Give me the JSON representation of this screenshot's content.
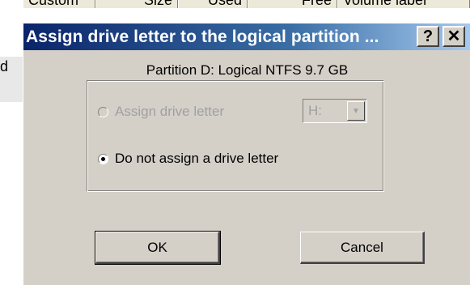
{
  "background_window": {
    "columns": [
      "Custom",
      "Size",
      "Used",
      "Free",
      "Volume label"
    ],
    "row_fragment": "d"
  },
  "dialog": {
    "title": "Assign drive letter to the logical partition ...",
    "help_label": "?",
    "close_label": "✕",
    "partition_info": "Partition D: Logical  NTFS  9.7 GB",
    "options": {
      "assign_label": "Assign drive letter",
      "assign_selected": false,
      "assign_enabled": false,
      "noassign_label": "Do not assign a drive letter",
      "noassign_selected": true
    },
    "drive_select": {
      "value": "H:",
      "arrow": "▼"
    },
    "ok_label": "OK",
    "cancel_label": "Cancel"
  },
  "colors": {
    "titlebar_start": "#0a246a",
    "titlebar_end": "#a6caf0",
    "dialog_face": "#d4d0c8",
    "disabled_text": "#a0a0a0"
  },
  "icons": {
    "help": "help-icon",
    "close": "close-icon",
    "dropdown": "chevron-down-icon"
  }
}
